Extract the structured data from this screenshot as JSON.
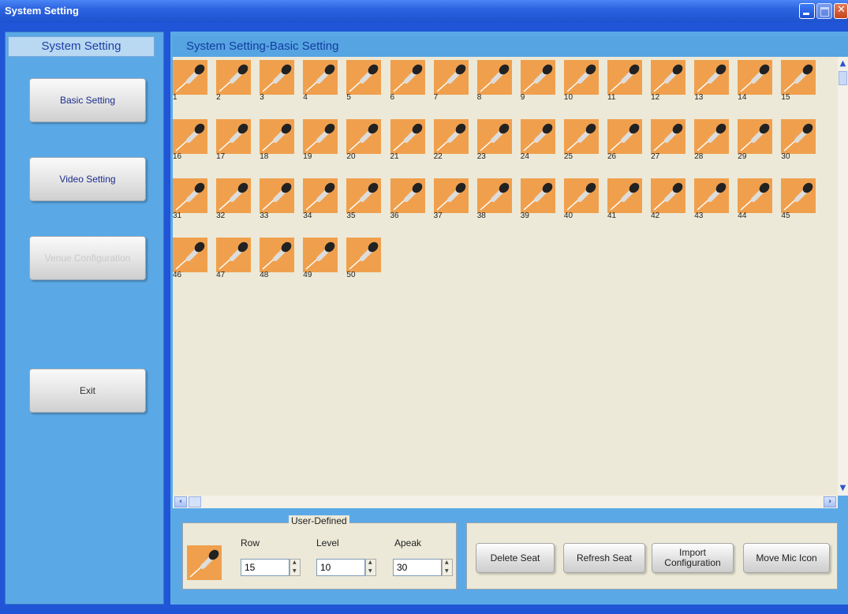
{
  "window": {
    "title": "System Setting"
  },
  "sidebar": {
    "header": "System Setting",
    "buttons": [
      {
        "label": "Basic Setting",
        "enabled": true
      },
      {
        "label": "Video Setting",
        "enabled": true
      },
      {
        "label": "Venue Configuration",
        "enabled": false
      },
      {
        "label": "Exit",
        "enabled": true
      }
    ]
  },
  "main": {
    "header": "System Setting-Basic Setting",
    "seat_icon": "microphone-icon",
    "seats": [
      "1",
      "2",
      "3",
      "4",
      "5",
      "6",
      "7",
      "8",
      "9",
      "10",
      "11",
      "12",
      "13",
      "14",
      "15",
      "16",
      "17",
      "18",
      "19",
      "20",
      "21",
      "22",
      "23",
      "24",
      "25",
      "26",
      "27",
      "28",
      "29",
      "30",
      "31",
      "32",
      "33",
      "34",
      "35",
      "36",
      "37",
      "38",
      "39",
      "40",
      "41",
      "42",
      "43",
      "44",
      "45",
      "46",
      "47",
      "48",
      "49",
      "50"
    ]
  },
  "user_defined": {
    "group_label": "User-Defined",
    "row_label": "Row",
    "row_value": "15",
    "level_label": "Level",
    "level_value": "10",
    "apeak_label": "Apeak",
    "apeak_value": "30"
  },
  "actions": {
    "delete_seat": "Delete Seat",
    "refresh_seat": "Refresh Seat",
    "import_configuration": "Import Configuration",
    "move_mic_icon": "Move Mic Icon"
  },
  "colors": {
    "tile": "#f0a04d",
    "panel": "#5aa9e6",
    "titlebar": "#2c64e0"
  }
}
